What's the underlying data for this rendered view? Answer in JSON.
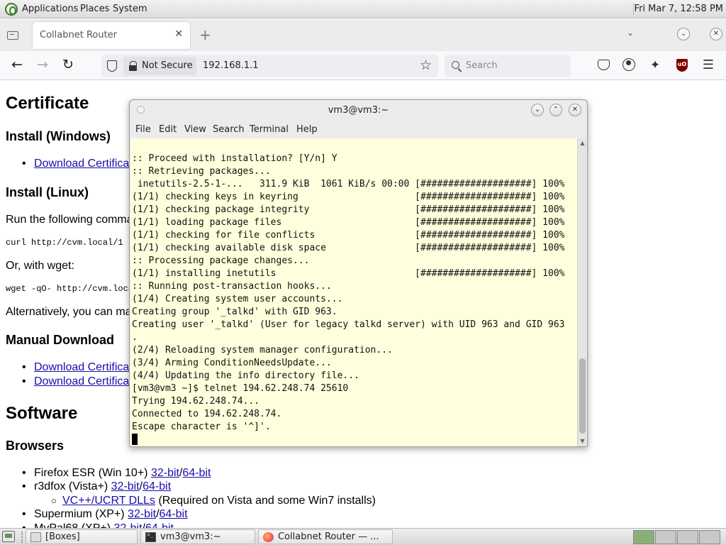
{
  "top_panel": {
    "menus": [
      "Applications",
      "Places",
      "System"
    ],
    "clock": "Fri Mar  7, 12:58 PM"
  },
  "browser": {
    "tab_title": "Collabnet Router",
    "tab_close": "✕",
    "new_tab": "+",
    "security_label": "Not Secure",
    "url": "192.168.1.1",
    "search_placeholder": "Search"
  },
  "page": {
    "h_certificate": "Certificate",
    "h_install_windows": "Install (Windows)",
    "link_download_cert_1": "Download Certifica",
    "h_install_linux": "Install (Linux)",
    "p_run": "Run the following comma",
    "code_curl": "curl http://cvm.local/1",
    "p_wget": "Or, with wget:",
    "code_wget": "wget -qO- http://cvm.loca",
    "p_alt": "Alternatively, you can ma",
    "h_manual": "Manual Download",
    "link_download_cert_2": "Download Certifica",
    "link_download_cert_3": "Download Certifica",
    "h_software": "Software",
    "h_browsers": "Browsers",
    "firefox_label": "Firefox ESR (Win 10+) ",
    "link_32": "32-bit",
    "slash": "/",
    "link_64": "64-bit",
    "r3dfox_label": "r3dfox (Vista+) ",
    "vcpp_link": "VC++/UCRT DLLs",
    "vcpp_note": " (Required on Vista and some Win7 installs)",
    "supermium_label": "Supermium (XP+) ",
    "mypal_label": "MyPal68 (XP+) "
  },
  "terminal": {
    "title": "vm3@vm3:~",
    "menus": [
      "File",
      "Edit",
      "View",
      "Search",
      "Terminal",
      "Help"
    ],
    "lines": [
      ":: Proceed with installation? [Y/n] Y",
      ":: Retrieving packages...",
      " inetutils-2.5-1-...   311.9 KiB  1061 KiB/s 00:00 [####################] 100%",
      "(1/1) checking keys in keyring                     [####################] 100%",
      "(1/1) checking package integrity                   [####################] 100%",
      "(1/1) loading package files                        [####################] 100%",
      "(1/1) checking for file conflicts                  [####################] 100%",
      "(1/1) checking available disk space                [####################] 100%",
      ":: Processing package changes...",
      "(1/1) installing inetutils                         [####################] 100%",
      ":: Running post-transaction hooks...",
      "(1/4) Creating system user accounts...",
      "Creating group '_talkd' with GID 963.",
      "Creating user '_talkd' (User for legacy talkd server) with UID 963 and GID 963",
      ".",
      "(2/4) Reloading system manager configuration...",
      "(3/4) Arming ConditionNeedsUpdate...",
      "(4/4) Updating the info directory file...",
      "[vm3@vm3 ~]$ telnet 194.62.248.74 25610",
      "Trying 194.62.248.74...",
      "Connected to 194.62.248.74.",
      "Escape character is '^]'."
    ]
  },
  "taskbar": {
    "tasks": [
      "[Boxes]",
      "vm3@vm3:~",
      "Collabnet Router — ..."
    ]
  },
  "colors": {
    "terminal_bg": "#ffffdd",
    "link": "#1a0dab",
    "ublock": "#800000"
  }
}
